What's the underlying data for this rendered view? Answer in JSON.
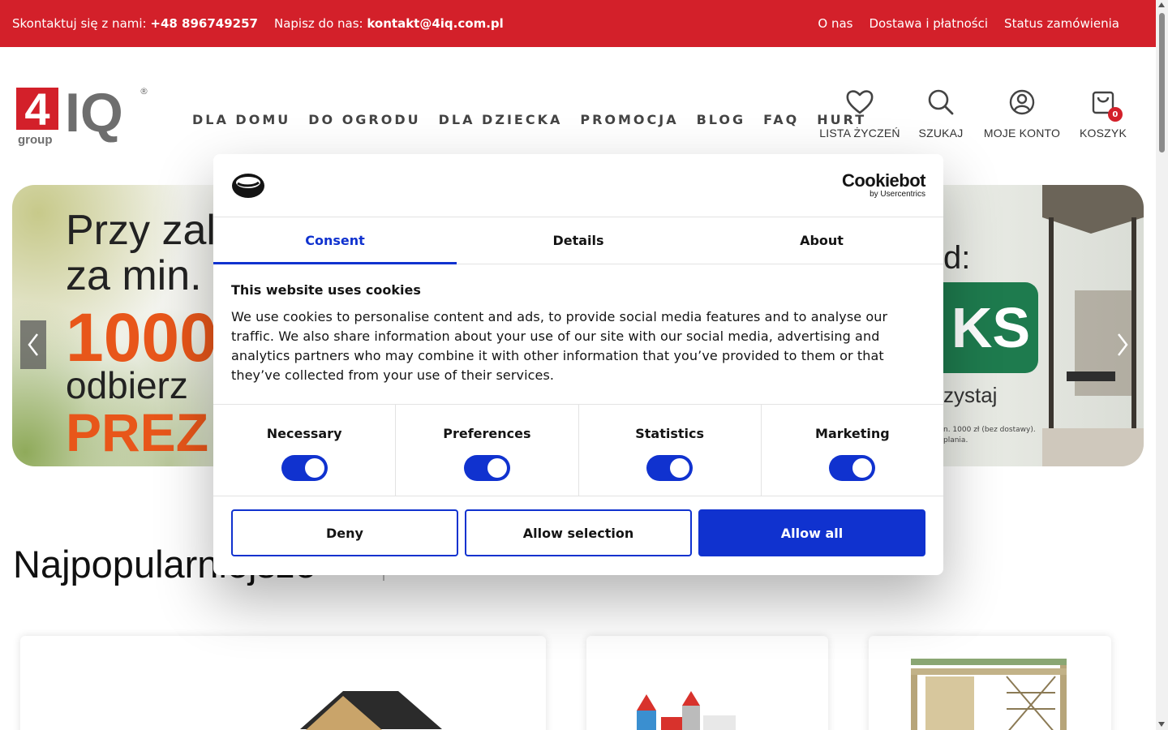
{
  "topbar": {
    "contact_label": "Skontaktuj się z nami:",
    "phone": "+48 896749257",
    "email_label": "Napisz do nas:",
    "email": "kontakt@4iq.com.pl",
    "links": [
      "O nas",
      "Dostawa i płatności",
      "Status zamówienia"
    ]
  },
  "logo": {
    "brand": "4IQ",
    "sub": "group",
    "reg": "®"
  },
  "nav": [
    "DLA DOMU",
    "DO OGRODU",
    "DLA DZIECKA",
    "PROMOCJA",
    "BLOG",
    "FAQ",
    "HURT"
  ],
  "header_icons": {
    "wishlist": "LISTA ŻYCZEŃ",
    "search": "SZUKAJ",
    "account": "MOJE KONTO",
    "cart": "KOSZYK",
    "cart_count": "0"
  },
  "hero": {
    "line1": "Przy zal",
    "line2": "za min.",
    "line3": "1000",
    "line4": "odbierz",
    "line5": "PREZ",
    "right_line": "d:",
    "badge_text": "KS",
    "right_sub": "zystaj",
    "fine_print_1": "n. 1000 zł (bez dostawy).",
    "fine_print_2": "plania."
  },
  "section": {
    "title": "Najpopularniejsze"
  },
  "cookie": {
    "brand": "Cookiebot",
    "brand_sub": "by Usercentrics",
    "tabs": [
      "Consent",
      "Details",
      "About"
    ],
    "heading": "This website uses cookies",
    "body": "We use cookies to personalise content and ads, to provide social media features and to analyse our traffic. We also share information about your use of our site with our social media, advertising and analytics partners who may combine it with other information that you’ve provided to them or that they’ve collected from your use of their services.",
    "toggles": [
      "Necessary",
      "Preferences",
      "Statistics",
      "Marketing"
    ],
    "buttons": {
      "deny": "Deny",
      "allow_selection": "Allow selection",
      "allow_all": "Allow all"
    }
  },
  "colors": {
    "brand_red": "#d3202a",
    "cookie_blue": "#1032cf",
    "promo_orange": "#e8561a",
    "promo_green": "#1e7b4e"
  }
}
